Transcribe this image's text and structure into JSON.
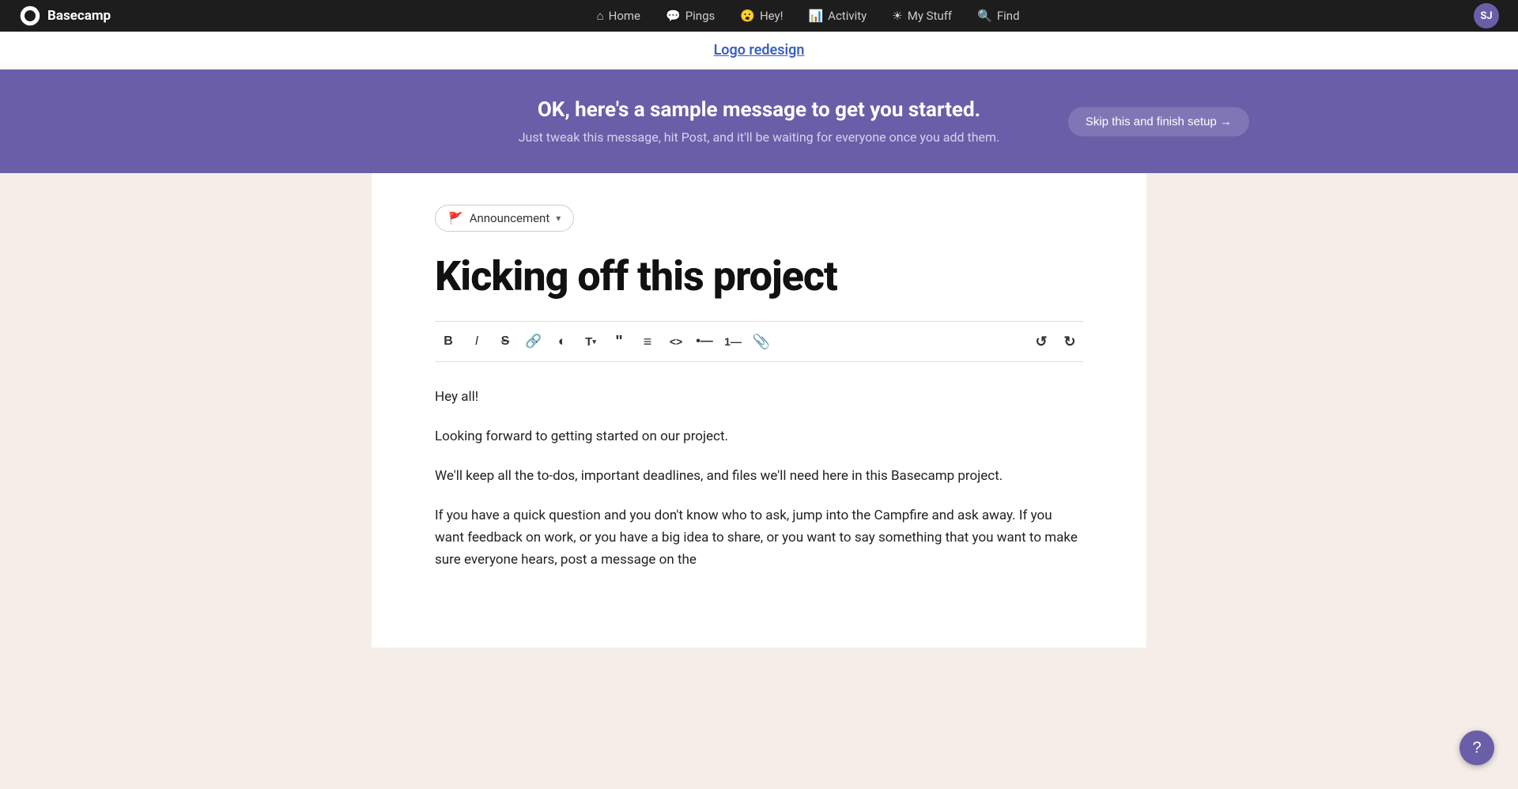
{
  "nav": {
    "logo_text": "Basecamp",
    "items": [
      {
        "id": "home",
        "label": "Home",
        "icon": "🏠"
      },
      {
        "id": "pings",
        "label": "Pings",
        "icon": "💬"
      },
      {
        "id": "hey",
        "label": "Hey!",
        "icon": "😀"
      },
      {
        "id": "activity",
        "label": "Activity",
        "icon": "📊"
      },
      {
        "id": "my-stuff",
        "label": "My Stuff",
        "icon": "☀️"
      },
      {
        "id": "find",
        "label": "Find",
        "icon": "🔍"
      }
    ],
    "avatar_initials": "SJ"
  },
  "project": {
    "title": "Logo redesign"
  },
  "banner": {
    "title": "OK, here's a sample message to get you started.",
    "subtitle": "Just tweak this message, hit Post, and it'll be waiting for everyone once you add them.",
    "skip_label": "Skip this and finish setup →"
  },
  "editor": {
    "announcement_label": "Announcement",
    "post_title": "Kicking off this project",
    "toolbar": {
      "bold": "B",
      "italic": "I",
      "strikethrough": "S̶",
      "link": "🔗",
      "highlight": "◐",
      "text_style": "T",
      "quote": "❝",
      "align": "≡",
      "code": "<>",
      "bullet_list": "•",
      "numbered_list": "1.",
      "attachment": "📎",
      "undo": "↺",
      "redo": "↻"
    },
    "content": [
      "Hey all!",
      "Looking forward to getting started on our project.",
      "We'll keep all the to-dos, important deadlines, and files we'll need here in this Basecamp project.",
      "If you have a quick question and you don't know who to ask, jump into the Campfire and ask away. If you want feedback on work, or you have a big idea to share, or you want to say something that you want to make sure everyone hears, post a message on the"
    ]
  },
  "help": {
    "icon": "?"
  }
}
